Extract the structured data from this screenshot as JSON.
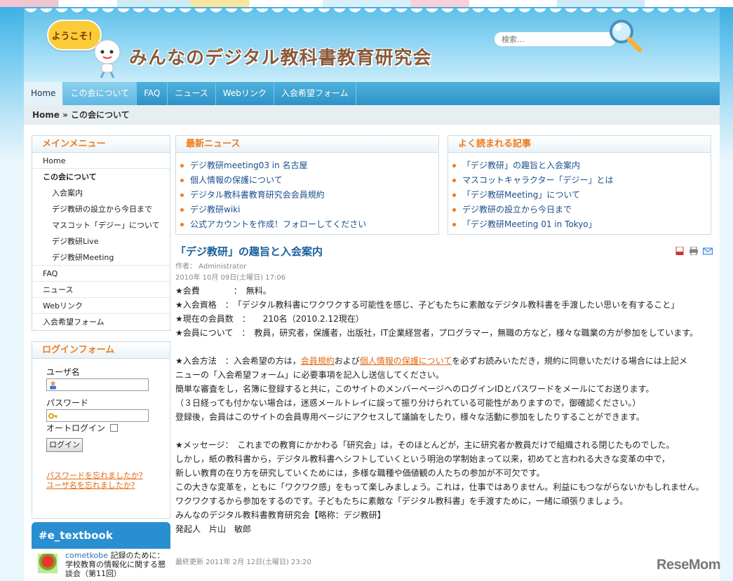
{
  "header": {
    "welcome": "ようこそ！",
    "site_title": "みんなのデジタル教科書教育研究会",
    "search_placeholder": "検索..."
  },
  "nav": {
    "items": [
      "Home",
      "この会について",
      "FAQ",
      "ニュース",
      "Webリンク",
      "入会希望フォーム"
    ],
    "active_index": 1
  },
  "breadcrumb": "Home » この会について",
  "sidebar": {
    "menu_title": "メインメニュー",
    "menu_items": [
      {
        "label": "Home",
        "level": 0
      },
      {
        "label": "この会について",
        "level": 0,
        "bold": true
      },
      {
        "label": "入会案内",
        "level": 1
      },
      {
        "label": "デジ教研の設立から今日まで",
        "level": 1
      },
      {
        "label": "マスコット「デジー」について",
        "level": 1
      },
      {
        "label": "デジ教研Live",
        "level": 1
      },
      {
        "label": "デジ教研Meeting",
        "level": 1
      },
      {
        "label": "FAQ",
        "level": 0
      },
      {
        "label": "ニュース",
        "level": 0
      },
      {
        "label": "Webリンク",
        "level": 0
      },
      {
        "label": "入会希望フォーム",
        "level": 0
      }
    ],
    "login": {
      "title": "ログインフォーム",
      "username_label": "ユーザ名",
      "password_label": "パスワード",
      "auto_login_label": "オートログイン",
      "login_button": "ログイン",
      "forgot_password": "パスワードを忘れましたか?",
      "forgot_username": "ユーザ名を忘れましたか?"
    },
    "twitter": {
      "title": "#e_textbook",
      "user": "cometkobe",
      "text": " 記録のために：学校教育の情報化に関する懇談会（第11回）"
    }
  },
  "latest_news": {
    "title": "最新ニュース",
    "items": [
      "デジ教研meeting03 in 名古屋",
      "個人情報の保護について",
      "デジタル教科書教育研究会会員規約",
      "デジ教研wiki",
      "公式アカウントを作成！フォローしてください"
    ]
  },
  "popular": {
    "title": "よく読まれる記事",
    "items": [
      "「デジ教研」の趣旨と入会案内",
      "マスコットキャラクター「デジー」とは",
      "「デジ教研Meeting」について",
      "デジ教研の設立から今日まで",
      "「デジ教研Meeting 01 in Tokyo」"
    ]
  },
  "article": {
    "title": "「デジ教研」の趣旨と入会案内",
    "author": "作者： Administrator",
    "date": "2010年 10月 09日(土曜日) 17:06",
    "lines": [
      "★会費　　　　：　無料。",
      "★入会資格　：　「デジタル教科書にワクワクする可能性を感じ、子どもたちに素敵なデジタル教科書を手渡したい思いを有すること」",
      "★現在の会員数　：　　210名（2010.2.12現在）",
      "★会員について　：　教員，研究者，保護者，出版社，IT企業経営者，プログラマー，無職の方など，様々な職業の方が参加をしています。"
    ],
    "join_prefix": "★入会方法　：入会希望の方は，",
    "join_link1": "会員規約",
    "join_mid": "および",
    "join_link2": "個人情報の保護について",
    "join_suffix": "を必ずお読みいただき，規約に同意いただける場合には上記メ",
    "lines2": [
      "ニューの「入会希望フォーム」に必要事項を記入し送信してください。",
      "簡単な審査をし，名簿に登録すると共に，このサイトのメンバーページへのログインIDとパスワードをメールにてお送ります。",
      "（３日経っても付かない場合は，迷惑メールトレイに誤って振り分けられている可能性がありますので，御確認ください。）",
      "登録後，会員はこのサイトの会員専用ページにアクセスして議論をしたり，様々な活動に参加をしたりすることができます。"
    ],
    "lines3": [
      "★メッセージ：　これまでの教育にかかわる「研究会」は，そのほとんどが，主に研究者か教員だけで組織される閉じたものでした。",
      "しかし，紙の教科書から，デジタル教科書へシフトしていくという明治の学制始まって以来，初めてと言われる大きな変革の中で，",
      "新しい教育の在り方を研究していくためには，多様な職種や価値観の人たちの参加が不可欠です。",
      "この大きな変革を，ともに「ワクワク感」をもって楽しみましょう。これは，仕事ではありません。利益にもつながらないかもしれません。",
      "ワクワクするから参加をするのです。子どもたちに素敵な「デジタル教科書」を手渡すために，一緒に頑張りましょう。",
      "みんなのデジタル教科書教育研究会【略称：デジ教研】",
      "発起人　片山　敏郎"
    ],
    "updated": "最終更新 2011年 2月 12日(土曜日) 23:20"
  },
  "watermark": "ReseMom",
  "colors": {
    "accent_orange": "#f07a1a",
    "link_blue": "#1a4f8a",
    "nav_blue": "#2d93c7"
  }
}
